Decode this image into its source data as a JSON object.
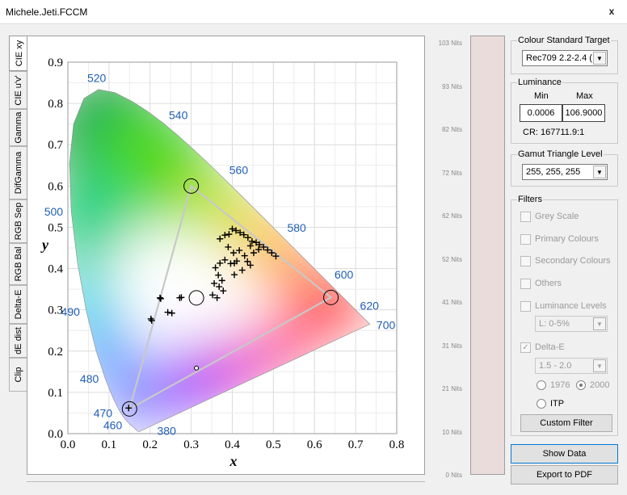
{
  "window": {
    "title": "Michele.Jeti.FCCM",
    "close_glyph": "x"
  },
  "tabs": [
    {
      "label": "CIE xy",
      "active": true
    },
    {
      "label": "CIE u'v'"
    },
    {
      "label": "Gamma"
    },
    {
      "label": "DifGamma"
    },
    {
      "label": "RGB Sep"
    },
    {
      "label": "RGB Bal"
    },
    {
      "label": "Delta-E"
    },
    {
      "label": "dE dist"
    },
    {
      "label": "Clip"
    }
  ],
  "chart_data": {
    "type": "scatter",
    "xlabel": "x",
    "ylabel": "y",
    "xlim": [
      0.0,
      0.8
    ],
    "ylim": [
      0.0,
      0.9
    ],
    "xticks": [
      "0.0",
      "0.1",
      "0.2",
      "0.3",
      "0.4",
      "0.5",
      "0.6",
      "0.7",
      "0.8"
    ],
    "yticks": [
      "0.0",
      "0.1",
      "0.2",
      "0.3",
      "0.4",
      "0.5",
      "0.6",
      "0.7",
      "0.8",
      "0.9"
    ],
    "grid": true,
    "wavelength_labels": [
      {
        "text": "380",
        "x": 0.174,
        "y": 0.005
      },
      {
        "text": "460",
        "x": 0.144,
        "y": 0.03
      },
      {
        "text": "470",
        "x": 0.124,
        "y": 0.058
      },
      {
        "text": "480",
        "x": 0.091,
        "y": 0.133
      },
      {
        "text": "490",
        "x": 0.045,
        "y": 0.295
      },
      {
        "text": "500",
        "x": 0.008,
        "y": 0.538
      },
      {
        "text": "520",
        "x": 0.074,
        "y": 0.834
      },
      {
        "text": "540",
        "x": 0.23,
        "y": 0.754
      },
      {
        "text": "560",
        "x": 0.373,
        "y": 0.625
      },
      {
        "text": "580",
        "x": 0.512,
        "y": 0.487
      },
      {
        "text": "600",
        "x": 0.627,
        "y": 0.372
      },
      {
        "text": "620",
        "x": 0.691,
        "y": 0.308
      },
      {
        "text": "700",
        "x": 0.735,
        "y": 0.265
      }
    ],
    "gamut_triangle": [
      [
        0.64,
        0.33
      ],
      [
        0.3,
        0.6
      ],
      [
        0.15,
        0.06
      ]
    ],
    "target_circles": [
      {
        "x": 0.64,
        "y": 0.33
      },
      {
        "x": 0.3,
        "y": 0.6
      },
      {
        "x": 0.15,
        "y": 0.06
      },
      {
        "x": 0.3127,
        "y": 0.329
      }
    ],
    "midpoint_marker": {
      "x": 0.3127,
      "y": 0.1589
    },
    "measured_points": [
      [
        0.148,
        0.062
      ],
      [
        0.224,
        0.329
      ],
      [
        0.226,
        0.327
      ],
      [
        0.202,
        0.278
      ],
      [
        0.204,
        0.274
      ],
      [
        0.243,
        0.294
      ],
      [
        0.253,
        0.292
      ],
      [
        0.272,
        0.329
      ],
      [
        0.276,
        0.33
      ],
      [
        0.37,
        0.472
      ],
      [
        0.382,
        0.481
      ],
      [
        0.392,
        0.483
      ],
      [
        0.4,
        0.496
      ],
      [
        0.409,
        0.492
      ],
      [
        0.419,
        0.487
      ],
      [
        0.428,
        0.482
      ],
      [
        0.438,
        0.475
      ],
      [
        0.448,
        0.466
      ],
      [
        0.458,
        0.463
      ],
      [
        0.466,
        0.458
      ],
      [
        0.476,
        0.452
      ],
      [
        0.486,
        0.445
      ],
      [
        0.496,
        0.438
      ],
      [
        0.506,
        0.43
      ],
      [
        0.39,
        0.452
      ],
      [
        0.403,
        0.438
      ],
      [
        0.417,
        0.444
      ],
      [
        0.43,
        0.431
      ],
      [
        0.444,
        0.455
      ],
      [
        0.452,
        0.438
      ],
      [
        0.37,
        0.413
      ],
      [
        0.382,
        0.421
      ],
      [
        0.396,
        0.412
      ],
      [
        0.411,
        0.418
      ],
      [
        0.359,
        0.402
      ],
      [
        0.366,
        0.384
      ],
      [
        0.375,
        0.371
      ],
      [
        0.405,
        0.385
      ],
      [
        0.424,
        0.396
      ],
      [
        0.444,
        0.408
      ],
      [
        0.356,
        0.364
      ],
      [
        0.368,
        0.356
      ],
      [
        0.378,
        0.346
      ],
      [
        0.352,
        0.336
      ],
      [
        0.363,
        0.329
      ],
      [
        0.405,
        0.413
      ],
      [
        0.437,
        0.417
      ],
      [
        0.464,
        0.446
      ]
    ]
  },
  "nits_labels": [
    "103 Nits",
    "93 Nits",
    "82 Nits",
    "72 Nits",
    "62 Nits",
    "52 Nits",
    "41 Nits",
    "31 Nits",
    "21 Nits",
    "10 Nits",
    "0 Nits"
  ],
  "colour_standard": {
    "legend": "Colour Standard Target",
    "value": "Rec709 2.2-2.4 ("
  },
  "luminance": {
    "legend": "Luminance",
    "min_label": "Min",
    "max_label": "Max",
    "min_value": "0.0006",
    "max_value": "106.9000",
    "cr": "CR: 167711.9:1"
  },
  "gamut_level": {
    "legend": "Gamut Triangle Level",
    "value": "255, 255, 255"
  },
  "filters": {
    "legend": "Filters",
    "grey_scale": "Grey Scale",
    "primary": "Primary Colours",
    "secondary": "Secondary Colours",
    "others": "Others",
    "luminance_levels": "Luminance Levels",
    "lum_combo": "L:   0-5%",
    "delta_e": "Delta-E",
    "de_combo": "1.5 - 2.0",
    "radio_1976": "1976",
    "radio_2000": "2000",
    "radio_itp": "ITP",
    "custom_filter": "Custom Filter"
  },
  "buttons": {
    "show_data": "Show Data",
    "export_pdf": "Export to PDF"
  },
  "colors": {
    "axis_label_blue": "#1f5fb4",
    "triangle": "#c8c8c8",
    "accent_focus": "#0078d7"
  }
}
